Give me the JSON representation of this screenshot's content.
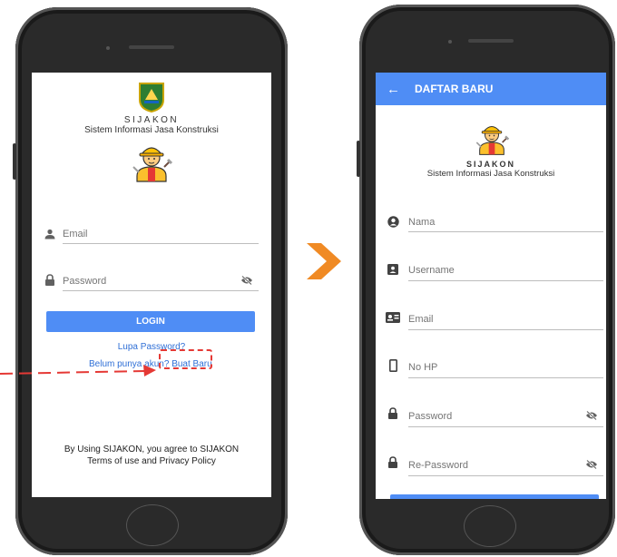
{
  "login": {
    "brand_name": "SIJAKON",
    "brand_subtitle": "Sistem Informasi Jasa Konstruksi",
    "email_placeholder": "Email",
    "password_placeholder": "Password",
    "login_button": "LOGIN",
    "forgot_link": "Lupa Password?",
    "signup_prompt": "Belum punya akun?",
    "signup_link": "Buat Baru",
    "terms_line1": "By Using SIJAKON, you agree to SIJAKON",
    "terms_line2": "Terms of use and Privacy Policy"
  },
  "register": {
    "header_title": "DAFTAR BARU",
    "brand_name": "SIJAKON",
    "brand_subtitle": "Sistem Informasi Jasa Konstruksi",
    "fields": [
      {
        "placeholder": "Nama",
        "icon": "account-circle-icon"
      },
      {
        "placeholder": "Username",
        "icon": "account-box-icon"
      },
      {
        "placeholder": "Email",
        "icon": "contact-card-icon"
      },
      {
        "placeholder": "No HP",
        "icon": "phone-icon"
      },
      {
        "placeholder": "Password",
        "icon": "lock-icon"
      },
      {
        "placeholder": "Re-Password",
        "icon": "lock-icon"
      }
    ]
  },
  "colors": {
    "primary": "#4f8df5",
    "link": "#2f6fd6",
    "annotation": "#e53935",
    "arrow": "#f08a24"
  }
}
